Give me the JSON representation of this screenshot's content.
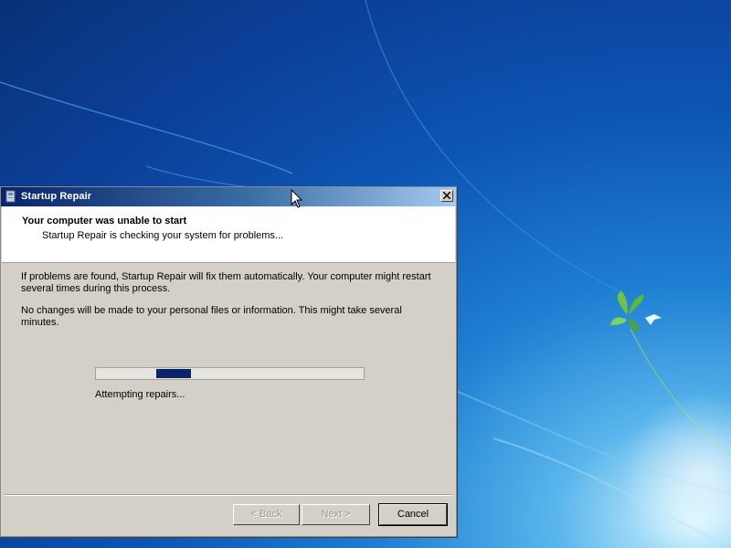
{
  "window": {
    "title": "Startup Repair",
    "icon": "startup-repair-icon",
    "close_icon": "close-icon"
  },
  "header": {
    "title": "Your computer was unable to start",
    "subtitle": "Startup Repair is checking your system for problems..."
  },
  "body": {
    "paragraph1": "If problems are found, Startup Repair will fix them automatically. Your computer might restart several times during this process.",
    "paragraph2": "No changes will be made to your personal files or information. This might take several minutes."
  },
  "progress": {
    "style": "marquee",
    "status": "Attempting repairs...",
    "color": "#0a246a"
  },
  "buttons": {
    "back": {
      "label": "< Back",
      "enabled": false
    },
    "next": {
      "label": "Next >",
      "enabled": false
    },
    "cancel": {
      "label": "Cancel",
      "enabled": true,
      "default": true
    }
  },
  "colors": {
    "title_bar_start": "#0a246a",
    "title_bar_end": "#a6caf0",
    "dialog_face": "#d4d0c8",
    "desktop": "#0d56b4"
  }
}
